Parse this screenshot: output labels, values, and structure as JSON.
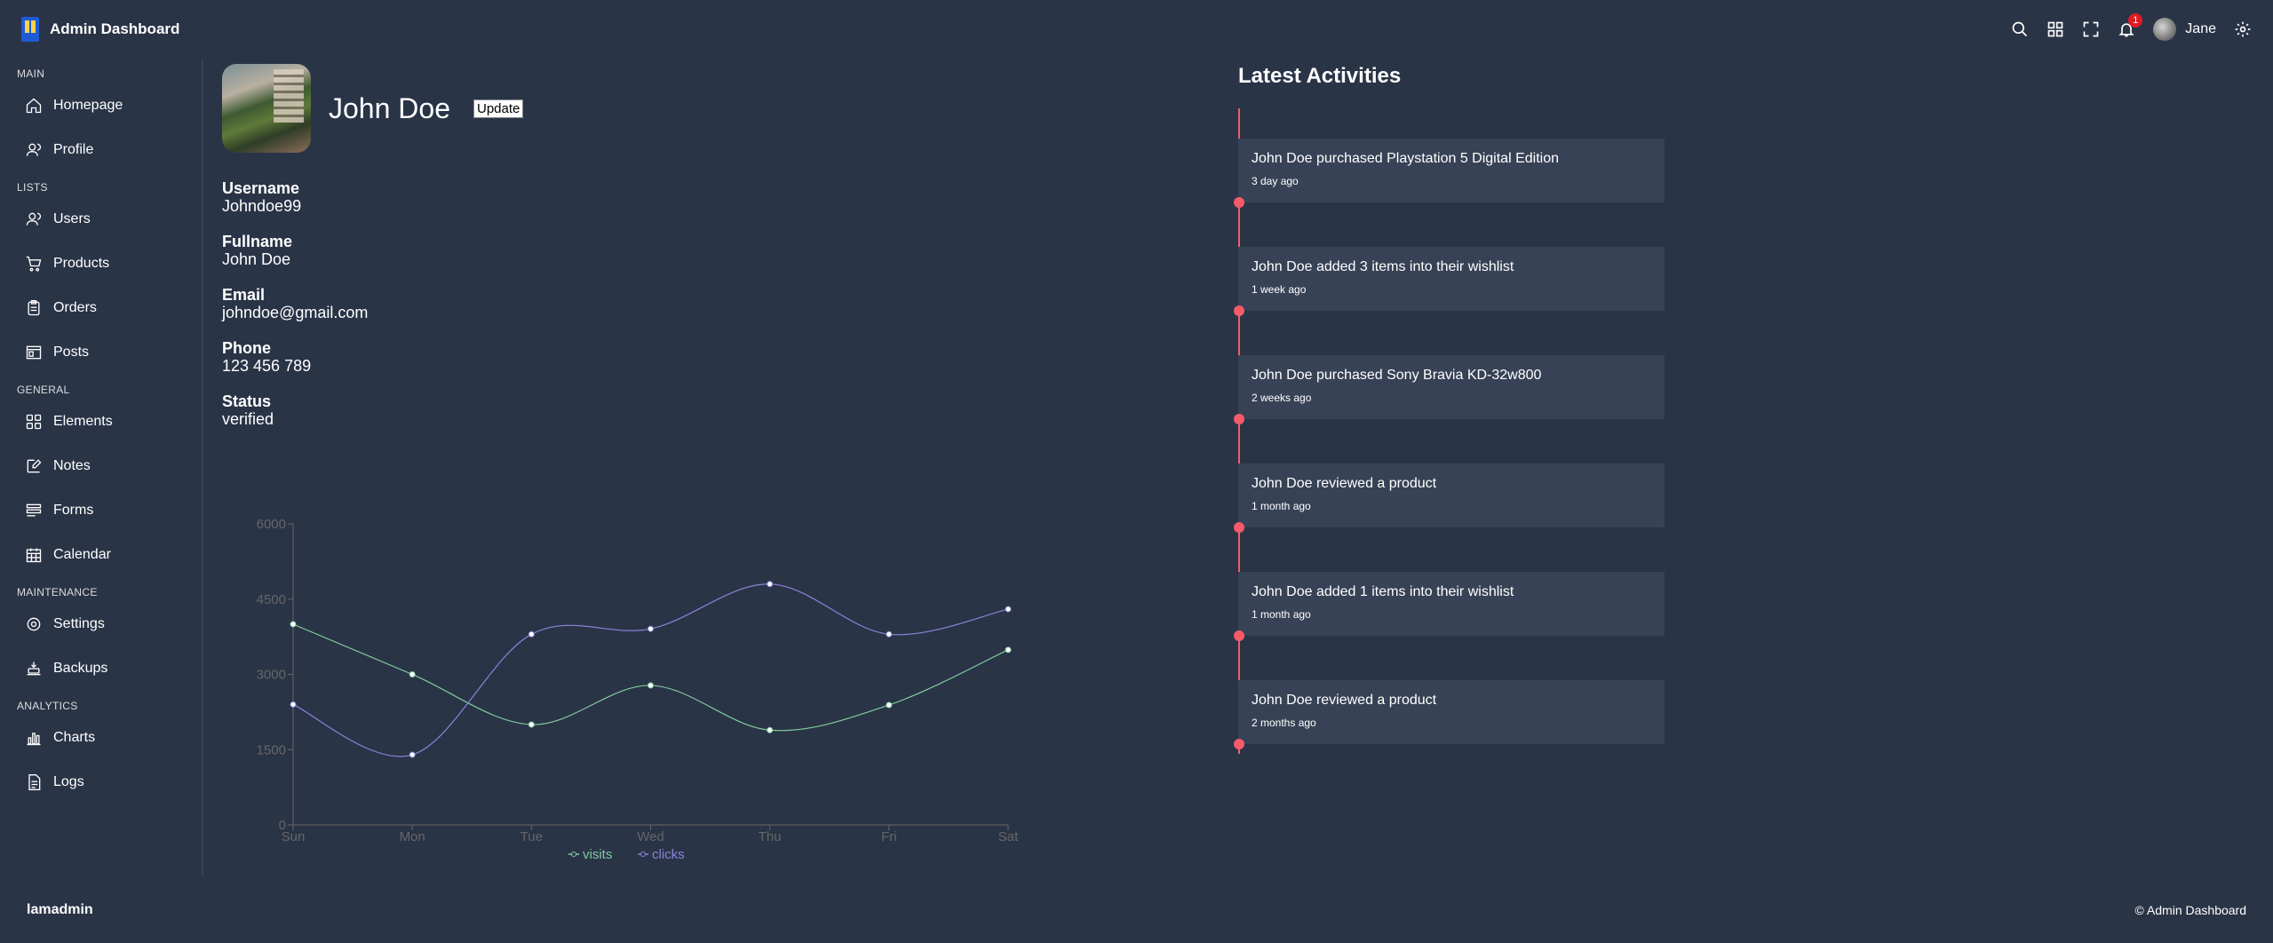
{
  "navbar": {
    "title": "Admin Dashboard",
    "notification_count": "1",
    "user_name": "Jane"
  },
  "sidebar": {
    "groups": [
      {
        "title": "MAIN",
        "items": [
          {
            "label": "Homepage",
            "icon": "home-icon"
          },
          {
            "label": "Profile",
            "icon": "profile-icon"
          }
        ]
      },
      {
        "title": "LISTS",
        "items": [
          {
            "label": "Users",
            "icon": "users-icon"
          },
          {
            "label": "Products",
            "icon": "cart-icon"
          },
          {
            "label": "Orders",
            "icon": "clipboard-icon"
          },
          {
            "label": "Posts",
            "icon": "posts-icon"
          }
        ]
      },
      {
        "title": "GENERAL",
        "items": [
          {
            "label": "Elements",
            "icon": "grid-icon"
          },
          {
            "label": "Notes",
            "icon": "edit-icon"
          },
          {
            "label": "Forms",
            "icon": "forms-icon"
          },
          {
            "label": "Calendar",
            "icon": "calendar-icon"
          }
        ]
      },
      {
        "title": "MAINTENANCE",
        "items": [
          {
            "label": "Settings",
            "icon": "gear-icon"
          },
          {
            "label": "Backups",
            "icon": "backup-icon"
          }
        ]
      },
      {
        "title": "ANALYTICS",
        "items": [
          {
            "label": "Charts",
            "icon": "bar-chart-icon"
          },
          {
            "label": "Logs",
            "icon": "logs-icon"
          }
        ]
      }
    ]
  },
  "profile": {
    "name": "John Doe",
    "update_label": "Update",
    "details": [
      {
        "label": "Username",
        "value": "Johndoe99"
      },
      {
        "label": "Fullname",
        "value": "John Doe"
      },
      {
        "label": "Email",
        "value": "johndoe@gmail.com"
      },
      {
        "label": "Phone",
        "value": "123 456 789"
      },
      {
        "label": "Status",
        "value": "verified"
      }
    ]
  },
  "chart_data": {
    "type": "line",
    "categories": [
      "Sun",
      "Mon",
      "Tue",
      "Wed",
      "Thu",
      "Fri",
      "Sat"
    ],
    "ylim": [
      0,
      6000
    ],
    "yticks": [
      0,
      1500,
      3000,
      4500,
      6000
    ],
    "series": [
      {
        "name": "visits",
        "color": "#82ca9d",
        "values": [
          4000,
          3000,
          2000,
          2780,
          1890,
          2390,
          3490
        ]
      },
      {
        "name": "clicks",
        "color": "#8884d8",
        "values": [
          2400,
          1398,
          3800,
          3908,
          4800,
          3800,
          4300
        ]
      }
    ],
    "legend_position": "bottom"
  },
  "activities": {
    "title": "Latest Activities",
    "items": [
      {
        "text": "John Doe purchased Playstation 5 Digital Edition",
        "time": "3 day ago"
      },
      {
        "text": "John Doe added 3 items into their wishlist",
        "time": "1 week ago"
      },
      {
        "text": "John Doe purchased Sony Bravia KD-32w800",
        "time": "2 weeks ago"
      },
      {
        "text": "John Doe reviewed a product",
        "time": "1 month ago"
      },
      {
        "text": "John Doe added 1 items into their wishlist",
        "time": "1 month ago"
      },
      {
        "text": "John Doe reviewed a product",
        "time": "2 months ago"
      }
    ]
  },
  "footer": {
    "brand": "lamadmin",
    "copyright": "© Admin Dashboard"
  },
  "colors": {
    "background": "#2a3447",
    "card": "#384256",
    "timeline": "#f45b69"
  }
}
